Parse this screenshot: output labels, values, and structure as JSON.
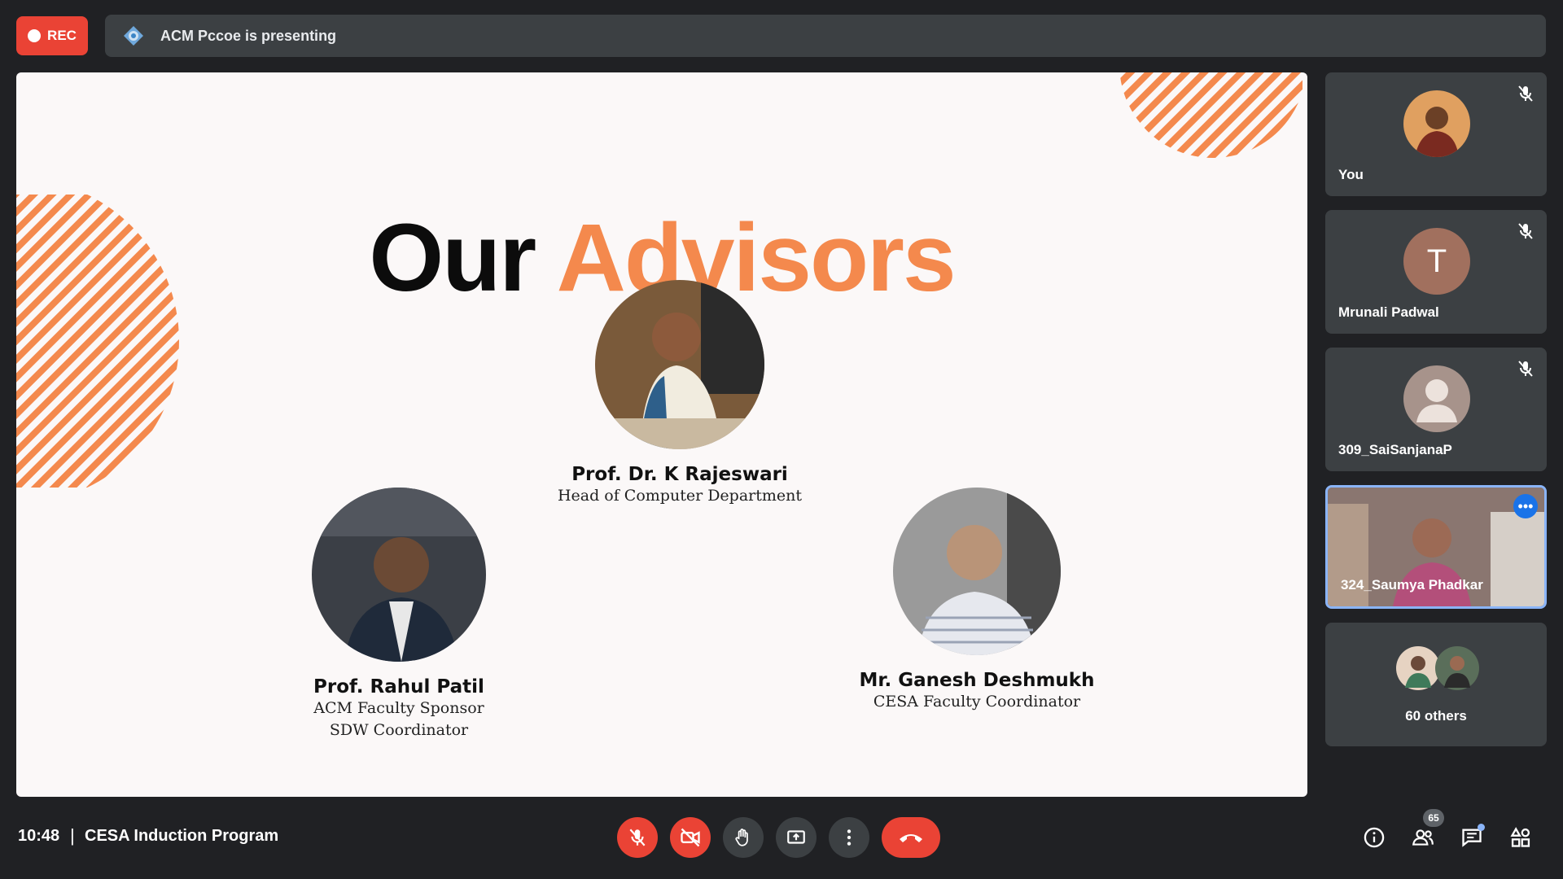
{
  "top_bar": {
    "rec_label": "REC",
    "presenting_text": "ACM Pccoe is presenting"
  },
  "slide": {
    "title_word1": "Our",
    "title_word2": "Advisors",
    "advisors": [
      {
        "name": "Prof. Dr. K Rajeswari",
        "role_line1": "Head of Computer Department",
        "role_line2": ""
      },
      {
        "name": "Prof. Rahul Patil",
        "role_line1": "ACM Faculty Sponsor",
        "role_line2": "SDW Coordinator"
      },
      {
        "name": "Mr. Ganesh Deshmukh",
        "role_line1": "CESA Faculty Coordinator",
        "role_line2": ""
      }
    ]
  },
  "participants": [
    {
      "name": "You",
      "muted": true
    },
    {
      "name": "Mrunali Padwal",
      "initial": "T",
      "muted": true
    },
    {
      "name": "309_SaiSanjanaP",
      "muted": true
    },
    {
      "name": "324_Saumya Phadkar",
      "active": true
    },
    {
      "name": "60 others"
    }
  ],
  "bottom_bar": {
    "time": "10:48",
    "separator": "|",
    "meeting_title": "CESA Induction Program",
    "participant_count": "65"
  },
  "colors": {
    "accent_orange": "#f4894d",
    "record_red": "#ea4335",
    "panel": "#3c4043",
    "background": "#202124",
    "active_border": "#8ab4f8"
  }
}
